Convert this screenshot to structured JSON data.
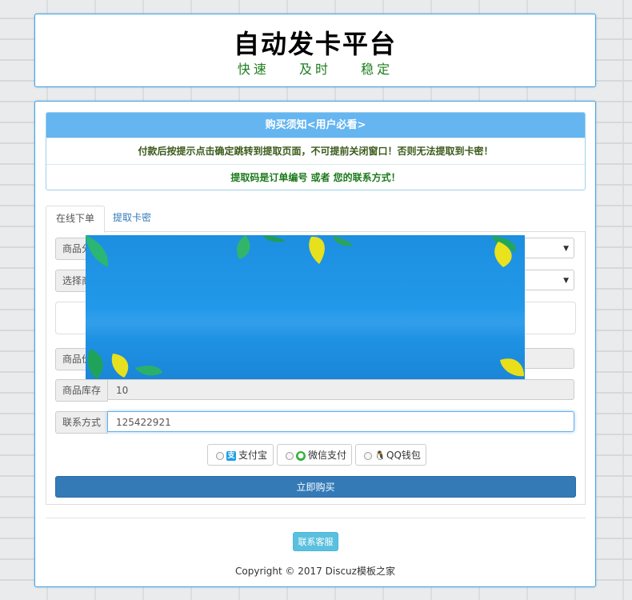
{
  "header": {
    "title": "自动发卡平台",
    "slogan": [
      "快速",
      "及时",
      "稳定"
    ]
  },
  "notice": {
    "heading": "购买须知<用户必看>",
    "line1": "付款后按提示点击确定跳转到提取页面，不可提前关闭窗口！否则无法提取到卡密！",
    "line2": "提取码是订单编号 或者 您的联系方式！"
  },
  "tabs": {
    "online_order": "在线下单",
    "extract_card": "提取卡密"
  },
  "form": {
    "category_label": "商品分类",
    "product_label": "选择商品",
    "price_label": "商品价格",
    "stock_label": "商品库存",
    "stock_value": "10",
    "contact_label": "联系方式",
    "contact_value": "125422921"
  },
  "payment": {
    "alipay": "支付宝",
    "wechat": "微信支付",
    "qq": "QQ钱包"
  },
  "buy_button": "立即购买",
  "service_button": "联系客服",
  "copyright": "Copyright © 2017 Discuz模板之家",
  "colors": {
    "accent": "#337ab7",
    "notice_header": "#65b5f1",
    "slogan": "#1f7d1f",
    "info_button": "#5bc0de",
    "banner_blue": "#1d8fe0"
  }
}
